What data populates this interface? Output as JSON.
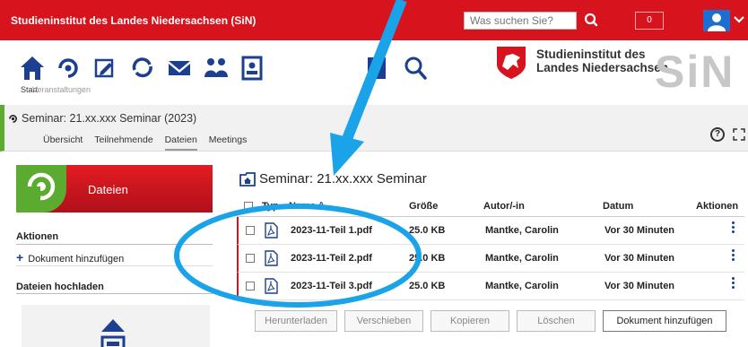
{
  "topbar": {
    "brand": "Studieninstitut des Landes Niedersachsen (SiN)",
    "search_placeholder": "Was suchen Sie?",
    "counter": "0"
  },
  "nav": {
    "start_label": "Start",
    "events_label": "Veranstaltungen",
    "logo_line1": "Studieninstitut des",
    "logo_line2": "Landes Niedersachsen",
    "logo_mark": "SiN"
  },
  "context": {
    "title": "Seminar: 21.xx.xxx Seminar (2023)",
    "tabs": [
      "Übersicht",
      "Teilnehmende",
      "Dateien",
      "Meetings"
    ],
    "active_tab": "Dateien",
    "help": "?"
  },
  "sidebar": {
    "tile_label": "Dateien",
    "actions_heading": "Aktionen",
    "add_doc_link": "Dokument hinzufügen",
    "upload_heading": "Dateien hochladen"
  },
  "main": {
    "title": "Seminar: 21.xx.xxx Seminar",
    "columns": [
      "Typ",
      "Name",
      "Größe",
      "Autor/-in",
      "Datum",
      "Aktionen"
    ],
    "sort_indicator": "^",
    "rows": [
      {
        "name": "2023-11-Teil 1.pdf",
        "size": "25.0 KB",
        "author": "Mantke, Carolin",
        "date": "Vor 30 Minuten"
      },
      {
        "name": "2023-11-Teil 2.pdf",
        "size": "25.0 KB",
        "author": "Mantke, Carolin",
        "date": "Vor 30 Minuten"
      },
      {
        "name": "2023-11-Teil 3.pdf",
        "size": "25.0 KB",
        "author": "Mantke, Carolin",
        "date": "Vor 30 Minuten"
      }
    ],
    "buttons": {
      "download": "Herunterladen",
      "move": "Verschieben",
      "copy": "Kopieren",
      "delete": "Löschen",
      "add": "Dokument hinzufügen"
    }
  },
  "colors": {
    "brand_red": "#d7141e",
    "accent_green": "#5aab2f",
    "icon_navy": "#1c3f8f",
    "annotation_blue": "#1aa3e8"
  }
}
